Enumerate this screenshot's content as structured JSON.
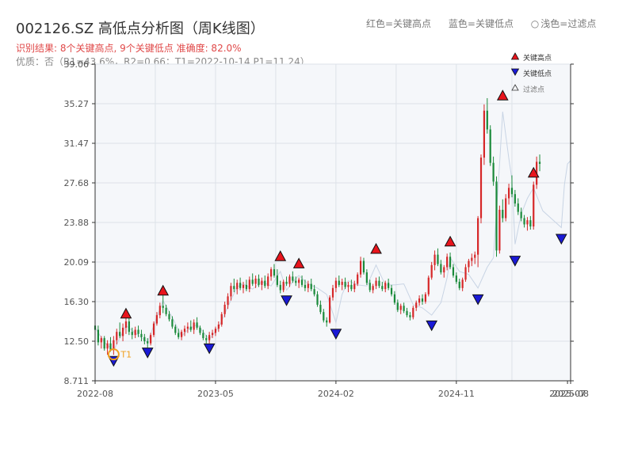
{
  "header": {
    "title": "002126.SZ 高低点分析图（周K线图）",
    "result_line": "识别结果: 8个关键高点, 9个关键低点  准确度: 82.0%",
    "quality_line": "优质：否（R1=43.6%，R2=0.66；T1=2022-10-14 P1=11.24）"
  },
  "top_legend": {
    "high": "红色=关键高点",
    "low": "蓝色=关键低点",
    "filtered": "浅色=过滤点"
  },
  "colors": {
    "up": "#d62728",
    "down": "#1a8a3a",
    "high_marker": "#e8141c",
    "low_marker": "#1a1ad6",
    "t1": "#f0a020",
    "plot_bg": "#f5f7fa",
    "grid": "#dde2e8"
  },
  "chart_data": {
    "type": "candlestick",
    "x_ticks": [
      "2022-08",
      "2023-05",
      "2024-02",
      "2024-11",
      "2025-07",
      "2025-08"
    ],
    "y_ticks": [
      "8.711",
      "12.50",
      "16.30",
      "20.09",
      "23.88",
      "27.68",
      "31.47",
      "35.27",
      "39.06"
    ],
    "ylim": [
      8.711,
      39.06
    ],
    "xlim_weeks": [
      0,
      154
    ],
    "grid": true,
    "legend_position": "top-right",
    "legend": [
      "关键高点",
      "关键低点",
      "过滤点"
    ],
    "t1_label": "T1",
    "t1": {
      "week": 6,
      "price": 11.24
    },
    "key_highs": [
      {
        "week": 10,
        "price": 14.5
      },
      {
        "week": 22,
        "price": 16.7
      },
      {
        "week": 60,
        "price": 20.0
      },
      {
        "week": 66,
        "price": 19.3
      },
      {
        "week": 91,
        "price": 20.7
      },
      {
        "week": 115,
        "price": 21.4
      },
      {
        "week": 132,
        "price": 35.4
      },
      {
        "week": 142,
        "price": 28.0
      }
    ],
    "key_lows": [
      {
        "week": 6,
        "price": 11.2
      },
      {
        "week": 17,
        "price": 12.0
      },
      {
        "week": 37,
        "price": 12.4
      },
      {
        "week": 62,
        "price": 17.0
      },
      {
        "week": 78,
        "price": 13.8
      },
      {
        "week": 109,
        "price": 14.6
      },
      {
        "week": 124,
        "price": 17.1
      },
      {
        "week": 136,
        "price": 20.8
      },
      {
        "week": 151,
        "price": 22.9
      }
    ],
    "close_path": [
      [
        0,
        13.8
      ],
      [
        3,
        12.4
      ],
      [
        6,
        11.6
      ],
      [
        10,
        14.0
      ],
      [
        13,
        13.3
      ],
      [
        17,
        12.4
      ],
      [
        20,
        14.8
      ],
      [
        22,
        16.4
      ],
      [
        25,
        14.8
      ],
      [
        28,
        13.0
      ],
      [
        30,
        13.6
      ],
      [
        33,
        14.1
      ],
      [
        37,
        12.7
      ],
      [
        40,
        13.8
      ],
      [
        43,
        15.8
      ],
      [
        46,
        17.7
      ],
      [
        48,
        18.0
      ],
      [
        51,
        17.5
      ],
      [
        54,
        18.2
      ],
      [
        57,
        17.8
      ],
      [
        60,
        19.2
      ],
      [
        62,
        17.4
      ],
      [
        64,
        18.2
      ],
      [
        66,
        18.8
      ],
      [
        69,
        18.0
      ],
      [
        72,
        17.6
      ],
      [
        75,
        17.0
      ],
      [
        78,
        14.3
      ],
      [
        80,
        17.0
      ],
      [
        82,
        18.3
      ],
      [
        85,
        17.9
      ],
      [
        88,
        17.8
      ],
      [
        91,
        19.8
      ],
      [
        94,
        17.9
      ],
      [
        97,
        17.9
      ],
      [
        100,
        18.0
      ],
      [
        103,
        16.0
      ],
      [
        106,
        15.7
      ],
      [
        109,
        15.0
      ],
      [
        112,
        16.2
      ],
      [
        114,
        18.6
      ],
      [
        115,
        20.5
      ],
      [
        118,
        19.2
      ],
      [
        121,
        18.9
      ],
      [
        124,
        17.6
      ],
      [
        127,
        19.6
      ],
      [
        129,
        20.5
      ],
      [
        131,
        29.5
      ],
      [
        132,
        34.5
      ],
      [
        134,
        30.0
      ],
      [
        135,
        28.0
      ],
      [
        136,
        21.8
      ],
      [
        138,
        24.7
      ],
      [
        140,
        26.2
      ],
      [
        142,
        27.2
      ],
      [
        145,
        25.0
      ],
      [
        148,
        24.2
      ],
      [
        151,
        23.4
      ],
      [
        152,
        27.5
      ],
      [
        153,
        29.5
      ],
      [
        154,
        29.8
      ]
    ],
    "candles": [
      [
        14.0,
        14.8,
        13.2,
        13.6
      ],
      [
        13.6,
        14.0,
        12.1,
        12.4
      ],
      [
        12.4,
        13.0,
        11.8,
        12.8
      ],
      [
        12.8,
        13.0,
        11.6,
        11.8
      ],
      [
        11.8,
        12.6,
        11.2,
        12.3
      ],
      [
        12.3,
        12.9,
        11.5,
        11.7
      ],
      [
        11.7,
        13.0,
        11.2,
        12.6
      ],
      [
        12.6,
        13.7,
        12.2,
        13.4
      ],
      [
        13.4,
        14.3,
        12.8,
        13.0
      ],
      [
        13.0,
        14.2,
        12.5,
        13.8
      ],
      [
        13.8,
        15.0,
        13.2,
        14.4
      ],
      [
        14.4,
        14.8,
        13.1,
        13.4
      ],
      [
        13.4,
        13.8,
        12.7,
        13.1
      ],
      [
        13.1,
        13.9,
        12.8,
        13.6
      ],
      [
        13.6,
        14.0,
        12.9,
        13.2
      ],
      [
        13.2,
        13.6,
        12.5,
        12.9
      ],
      [
        12.9,
        13.2,
        12.2,
        12.5
      ],
      [
        12.5,
        12.8,
        11.9,
        12.3
      ],
      [
        12.3,
        13.3,
        12.1,
        13.1
      ],
      [
        13.1,
        14.4,
        12.9,
        14.2
      ],
      [
        14.2,
        15.3,
        14.0,
        15.0
      ],
      [
        15.0,
        16.2,
        14.7,
        15.9
      ],
      [
        15.9,
        16.9,
        15.2,
        15.7
      ],
      [
        15.7,
        16.0,
        14.9,
        15.1
      ],
      [
        15.1,
        15.4,
        14.4,
        14.6
      ],
      [
        14.6,
        14.9,
        13.7,
        13.9
      ],
      [
        13.9,
        14.1,
        13.1,
        13.3
      ],
      [
        13.3,
        13.7,
        12.7,
        12.9
      ],
      [
        12.9,
        13.6,
        12.6,
        13.4
      ],
      [
        13.4,
        14.0,
        13.0,
        13.7
      ],
      [
        13.7,
        14.3,
        13.3,
        13.9
      ],
      [
        13.9,
        14.5,
        13.4,
        13.6
      ],
      [
        13.6,
        14.6,
        13.2,
        14.3
      ],
      [
        14.3,
        14.8,
        13.6,
        13.8
      ],
      [
        13.8,
        14.0,
        13.1,
        13.3
      ],
      [
        13.3,
        13.6,
        12.6,
        12.8
      ],
      [
        12.8,
        13.1,
        12.3,
        12.6
      ],
      [
        12.6,
        13.4,
        12.3,
        13.1
      ],
      [
        13.1,
        13.6,
        12.8,
        13.3
      ],
      [
        13.3,
        13.9,
        13.0,
        13.7
      ],
      [
        13.7,
        14.4,
        13.4,
        14.1
      ],
      [
        14.1,
        15.3,
        13.9,
        15.1
      ],
      [
        15.1,
        16.3,
        14.8,
        16.0
      ],
      [
        16.0,
        17.1,
        15.6,
        16.8
      ],
      [
        16.8,
        18.1,
        16.4,
        17.8
      ],
      [
        17.8,
        18.5,
        17.2,
        17.5
      ],
      [
        17.5,
        18.4,
        17.0,
        18.1
      ],
      [
        18.1,
        18.6,
        17.4,
        17.6
      ],
      [
        17.6,
        18.2,
        17.1,
        17.9
      ],
      [
        17.9,
        18.4,
        17.3,
        17.5
      ],
      [
        17.5,
        18.7,
        17.2,
        18.4
      ],
      [
        18.4,
        19.0,
        17.8,
        18.0
      ],
      [
        18.0,
        18.8,
        17.6,
        18.5
      ],
      [
        18.5,
        18.9,
        17.7,
        17.9
      ],
      [
        17.9,
        18.6,
        17.4,
        18.3
      ],
      [
        18.3,
        18.8,
        17.6,
        17.8
      ],
      [
        17.8,
        19.0,
        17.5,
        18.7
      ],
      [
        18.7,
        19.6,
        18.3,
        19.4
      ],
      [
        19.4,
        19.9,
        18.6,
        18.8
      ],
      [
        18.8,
        19.4,
        17.7,
        17.9
      ],
      [
        17.9,
        18.3,
        17.1,
        17.4
      ],
      [
        17.4,
        18.4,
        17.2,
        18.2
      ],
      [
        18.2,
        18.7,
        17.8,
        18.0
      ],
      [
        18.0,
        18.9,
        17.7,
        18.7
      ],
      [
        18.7,
        19.2,
        18.1,
        18.3
      ],
      [
        18.3,
        18.7,
        17.8,
        18.1
      ],
      [
        18.1,
        18.6,
        17.6,
        18.4
      ],
      [
        18.4,
        18.8,
        17.7,
        17.9
      ],
      [
        17.9,
        18.4,
        17.3,
        17.6
      ],
      [
        17.6,
        18.3,
        17.2,
        18.0
      ],
      [
        18.0,
        18.5,
        17.3,
        17.5
      ],
      [
        17.5,
        17.9,
        16.8,
        17.0
      ],
      [
        17.0,
        17.3,
        15.8,
        16.0
      ],
      [
        16.0,
        16.4,
        15.1,
        15.3
      ],
      [
        15.3,
        15.6,
        14.3,
        14.5
      ],
      [
        14.5,
        14.8,
        13.9,
        14.3
      ],
      [
        14.3,
        16.9,
        14.2,
        16.7
      ],
      [
        16.7,
        17.9,
        16.4,
        17.6
      ],
      [
        17.6,
        18.6,
        17.2,
        18.3
      ],
      [
        18.3,
        18.8,
        17.7,
        17.9
      ],
      [
        17.9,
        18.5,
        17.4,
        18.2
      ],
      [
        18.2,
        18.6,
        17.5,
        17.7
      ],
      [
        17.7,
        18.2,
        17.2,
        17.9
      ],
      [
        17.9,
        18.4,
        17.3,
        17.5
      ],
      [
        17.5,
        18.3,
        17.2,
        18.0
      ],
      [
        18.0,
        19.1,
        17.8,
        18.9
      ],
      [
        18.9,
        20.6,
        18.6,
        20.2
      ],
      [
        20.2,
        20.5,
        18.9,
        19.1
      ],
      [
        19.1,
        19.4,
        17.9,
        18.1
      ],
      [
        18.1,
        18.4,
        17.2,
        17.4
      ],
      [
        17.4,
        18.0,
        17.1,
        17.8
      ],
      [
        17.8,
        18.6,
        17.5,
        18.3
      ],
      [
        18.3,
        18.7,
        17.6,
        17.8
      ],
      [
        17.8,
        18.2,
        17.3,
        17.5
      ],
      [
        17.5,
        18.3,
        17.2,
        18.1
      ],
      [
        18.1,
        18.5,
        17.4,
        17.6
      ],
      [
        17.6,
        17.9,
        16.8,
        17.0
      ],
      [
        17.0,
        17.3,
        16.0,
        16.2
      ],
      [
        16.2,
        16.5,
        15.3,
        15.5
      ],
      [
        15.5,
        16.1,
        15.1,
        15.9
      ],
      [
        15.9,
        16.2,
        15.2,
        15.4
      ],
      [
        15.4,
        15.7,
        14.8,
        15.0
      ],
      [
        15.0,
        15.3,
        14.5,
        14.8
      ],
      [
        14.8,
        15.9,
        14.6,
        15.7
      ],
      [
        15.7,
        16.4,
        15.4,
        16.2
      ],
      [
        16.2,
        16.9,
        15.9,
        16.6
      ],
      [
        16.6,
        17.0,
        16.0,
        16.3
      ],
      [
        16.3,
        17.2,
        16.1,
        17.0
      ],
      [
        17.0,
        18.8,
        16.8,
        18.6
      ],
      [
        18.6,
        20.1,
        18.4,
        19.8
      ],
      [
        19.8,
        21.2,
        19.3,
        20.8
      ],
      [
        20.8,
        21.4,
        19.7,
        19.9
      ],
      [
        19.9,
        20.3,
        18.9,
        19.1
      ],
      [
        19.1,
        19.8,
        18.6,
        19.6
      ],
      [
        19.6,
        20.9,
        19.3,
        20.6
      ],
      [
        20.6,
        21.0,
        19.4,
        19.6
      ],
      [
        19.6,
        19.9,
        18.6,
        18.8
      ],
      [
        18.8,
        19.1,
        18.0,
        18.2
      ],
      [
        18.2,
        18.5,
        17.4,
        17.6
      ],
      [
        17.6,
        18.6,
        17.3,
        18.4
      ],
      [
        18.4,
        19.9,
        18.2,
        19.6
      ],
      [
        19.6,
        20.4,
        19.1,
        20.2
      ],
      [
        20.2,
        20.9,
        19.7,
        20.5
      ],
      [
        20.5,
        21.1,
        19.9,
        20.8
      ],
      [
        20.8,
        24.5,
        19.6,
        24.3
      ],
      [
        24.3,
        30.4,
        23.8,
        30.1
      ],
      [
        30.1,
        35.2,
        29.4,
        34.6
      ],
      [
        34.6,
        35.8,
        32.4,
        32.8
      ],
      [
        32.8,
        33.2,
        29.3,
        29.6
      ],
      [
        29.6,
        30.2,
        27.4,
        27.8
      ],
      [
        27.8,
        28.3,
        20.6,
        21.2
      ],
      [
        21.2,
        25.5,
        20.9,
        25.1
      ],
      [
        25.1,
        26.1,
        23.9,
        24.3
      ],
      [
        24.3,
        26.6,
        24.0,
        26.2
      ],
      [
        26.2,
        27.6,
        25.6,
        27.2
      ],
      [
        27.2,
        28.4,
        26.3,
        26.6
      ],
      [
        26.6,
        27.0,
        25.4,
        25.7
      ],
      [
        25.7,
        26.2,
        24.6,
        24.9
      ],
      [
        24.9,
        25.3,
        24.0,
        24.3
      ],
      [
        24.3,
        24.6,
        23.4,
        23.7
      ],
      [
        23.7,
        24.4,
        23.1,
        24.1
      ],
      [
        24.1,
        24.5,
        23.2,
        23.5
      ],
      [
        23.5,
        27.8,
        23.2,
        27.5
      ],
      [
        27.5,
        30.2,
        27.1,
        29.7
      ],
      [
        29.7,
        30.4,
        28.8,
        29.5
      ]
    ]
  }
}
